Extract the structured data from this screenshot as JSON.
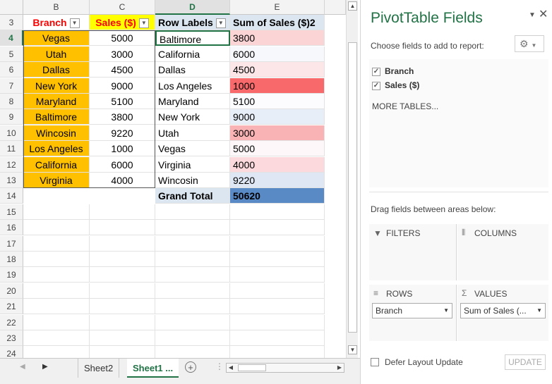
{
  "columns": [
    "B",
    "C",
    "D",
    "E"
  ],
  "rows": [
    "3",
    "4",
    "5",
    "6",
    "7",
    "8",
    "9",
    "10",
    "11",
    "12",
    "13",
    "14",
    "15",
    "16",
    "17",
    "18",
    "19",
    "20",
    "21",
    "22",
    "23",
    "24"
  ],
  "source_headers": {
    "branch": "Branch",
    "sales": "Sales ($)"
  },
  "source_rows": [
    {
      "branch": "Vegas",
      "sales": "5000"
    },
    {
      "branch": "Utah",
      "sales": "3000"
    },
    {
      "branch": "Dallas",
      "sales": "4500"
    },
    {
      "branch": "New York",
      "sales": "9000"
    },
    {
      "branch": "Maryland",
      "sales": "5100"
    },
    {
      "branch": "Baltimore",
      "sales": "3800"
    },
    {
      "branch": "Wincosin",
      "sales": "9220"
    },
    {
      "branch": "Los Angeles",
      "sales": "1000"
    },
    {
      "branch": "California",
      "sales": "6000"
    },
    {
      "branch": "Virginia",
      "sales": "4000"
    }
  ],
  "pivot_headers": {
    "labels": "Row Labels",
    "sum": "Sum of Sales ($)2"
  },
  "pivot_rows": [
    {
      "label": "Baltimore",
      "value": "3800",
      "color": "#fbd4d6"
    },
    {
      "label": "California",
      "value": "6000",
      "color": "#f7f8fc"
    },
    {
      "label": "Dallas",
      "value": "4500",
      "color": "#fce6e8"
    },
    {
      "label": "Los Angeles",
      "value": "1000",
      "color": "#f8696b"
    },
    {
      "label": "Maryland",
      "value": "5100",
      "color": "#fcfcff"
    },
    {
      "label": "New York",
      "value": "9000",
      "color": "#e8eef8"
    },
    {
      "label": "Utah",
      "value": "3000",
      "color": "#f9b3b5"
    },
    {
      "label": "Vegas",
      "value": "5000",
      "color": "#fdf7f9"
    },
    {
      "label": "Virginia",
      "value": "4000",
      "color": "#fbd9dc"
    },
    {
      "label": "Wincosin",
      "value": "9220",
      "color": "#dfe7f5"
    }
  ],
  "pivot_total": {
    "label": "Grand Total",
    "value": "50620",
    "color": "#5a8ac6"
  },
  "tabs": {
    "sheet2": "Sheet2",
    "sheet1": "Sheet1 ..."
  },
  "pane": {
    "title": "PivotTable Fields",
    "choose": "Choose fields to add to report:",
    "fields": [
      {
        "name": "Branch",
        "checked": true
      },
      {
        "name": "Sales ($)",
        "checked": true
      }
    ],
    "more_tables": "MORE TABLES...",
    "drag_hint": "Drag fields between areas below:",
    "filters": "FILTERS",
    "columns": "COLUMNS",
    "rows": "ROWS",
    "values": "VALUES",
    "rows_item": "Branch",
    "values_item": "Sum of Sales (...",
    "defer": "Defer Layout Update",
    "update": "UPDATE"
  }
}
